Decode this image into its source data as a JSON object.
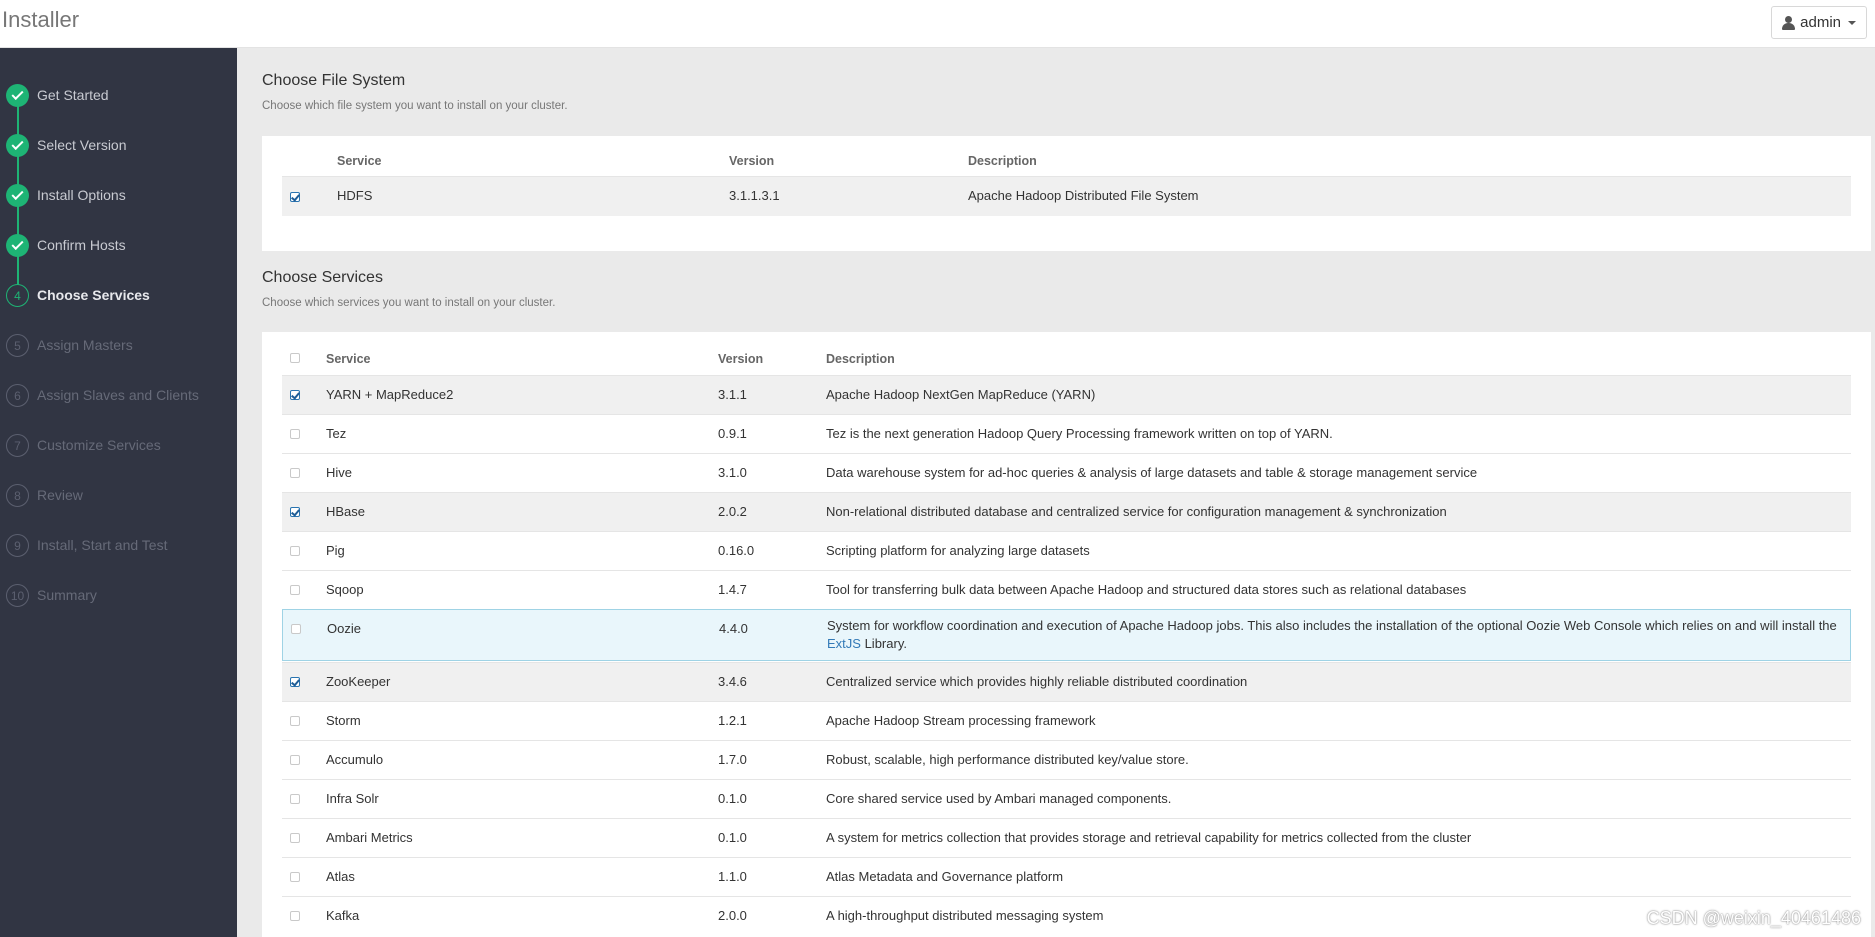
{
  "header": {
    "title": "Installer",
    "user_label": "admin"
  },
  "steps": [
    {
      "num": "1",
      "label": "Get Started",
      "state": "done"
    },
    {
      "num": "2",
      "label": "Select Version",
      "state": "done"
    },
    {
      "num": "3",
      "label": "Install Options",
      "state": "done"
    },
    {
      "num": "4",
      "label": "Confirm Hosts",
      "state": "done"
    },
    {
      "num": "4",
      "label": "Choose Services",
      "state": "current"
    },
    {
      "num": "5",
      "label": "Assign Masters",
      "state": "todo"
    },
    {
      "num": "6",
      "label": "Assign Slaves and Clients",
      "state": "todo"
    },
    {
      "num": "7",
      "label": "Customize Services",
      "state": "todo"
    },
    {
      "num": "8",
      "label": "Review",
      "state": "todo"
    },
    {
      "num": "9",
      "label": "Install, Start and Test",
      "state": "todo"
    },
    {
      "num": "10",
      "label": "Summary",
      "state": "todo"
    }
  ],
  "filesystem": {
    "title": "Choose File System",
    "subtitle": "Choose which file system you want to install on your cluster.",
    "columns": {
      "service": "Service",
      "version": "Version",
      "description": "Description"
    },
    "rows": [
      {
        "service": "HDFS",
        "version": "3.1.1.3.1",
        "description": "Apache Hadoop Distributed File System",
        "checked": true
      }
    ]
  },
  "services": {
    "title": "Choose Services",
    "subtitle": "Choose which services you want to install on your cluster.",
    "columns": {
      "service": "Service",
      "version": "Version",
      "description": "Description"
    },
    "rows": [
      {
        "service": "YARN + MapReduce2",
        "version": "3.1.1",
        "description": "Apache Hadoop NextGen MapReduce (YARN)",
        "checked": true
      },
      {
        "service": "Tez",
        "version": "0.9.1",
        "description": "Tez is the next generation Hadoop Query Processing framework written on top of YARN.",
        "checked": false
      },
      {
        "service": "Hive",
        "version": "3.1.0",
        "description": "Data warehouse system for ad-hoc queries & analysis of large datasets and table & storage management service",
        "checked": false
      },
      {
        "service": "HBase",
        "version": "2.0.2",
        "description": "Non-relational distributed database and centralized service for configuration management & synchronization",
        "checked": true
      },
      {
        "service": "Pig",
        "version": "0.16.0",
        "description": "Scripting platform for analyzing large datasets",
        "checked": false
      },
      {
        "service": "Sqoop",
        "version": "1.4.7",
        "description": "Tool for transferring bulk data between Apache Hadoop and structured data stores such as relational databases",
        "checked": false
      },
      {
        "service": "Oozie",
        "version": "4.4.0",
        "description_pre": "System for workflow coordination and execution of Apache Hadoop jobs. This also includes the installation of the optional Oozie Web Console which relies on and will install the ",
        "description_link": "ExtJS",
        "description_post": " Library.",
        "checked": false
      },
      {
        "service": "ZooKeeper",
        "version": "3.4.6",
        "description": "Centralized service which provides highly reliable distributed coordination",
        "checked": true
      },
      {
        "service": "Storm",
        "version": "1.2.1",
        "description": "Apache Hadoop Stream processing framework",
        "checked": false
      },
      {
        "service": "Accumulo",
        "version": "1.7.0",
        "description": "Robust, scalable, high performance distributed key/value store.",
        "checked": false
      },
      {
        "service": "Infra Solr",
        "version": "0.1.0",
        "description": "Core shared service used by Ambari managed components.",
        "checked": false
      },
      {
        "service": "Ambari Metrics",
        "version": "0.1.0",
        "description": "A system for metrics collection that provides storage and retrieval capability for metrics collected from the cluster",
        "checked": false
      },
      {
        "service": "Atlas",
        "version": "1.1.0",
        "description": "Atlas Metadata and Governance platform",
        "checked": false
      },
      {
        "service": "Kafka",
        "version": "2.0.0",
        "description": "A high-throughput distributed messaging system",
        "checked": false
      }
    ]
  },
  "watermark": "CSDN @weixin_40461486"
}
